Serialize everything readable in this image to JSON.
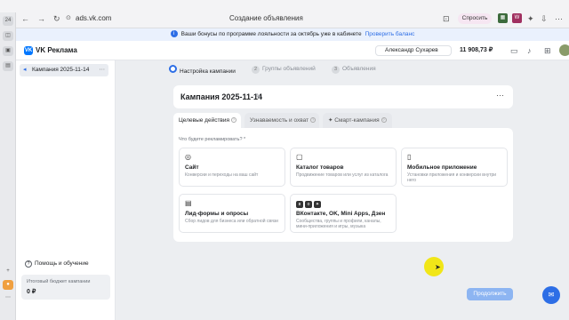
{
  "browser": {
    "address": "ads.vk.com",
    "page_title": "Создание объявления",
    "ask_label": "Спросить",
    "vtabs": [
      "24",
      "◫",
      "▣",
      "▤"
    ]
  },
  "banner": {
    "text": "Ваши бонусы по программе лояльности за октябрь уже в кабинете",
    "link": "Проверить баланс"
  },
  "header": {
    "logo": "VK Реклама",
    "account": "Александр Сухарев",
    "balance": "11 908,73 ₽"
  },
  "sidebar": {
    "campaign": "Кампания 2025-11-14",
    "help": "Помощь и обучение",
    "budget_label": "Итоговый бюджет кампании",
    "budget_value": "0 ₽"
  },
  "stepper": [
    {
      "num": "1",
      "label": "Настройка кампании"
    },
    {
      "num": "2",
      "label": "Группы объявлений"
    },
    {
      "num": "3",
      "label": "Объявления"
    }
  ],
  "campaign_title": "Кампания 2025-11-14",
  "tabs": [
    {
      "label": "Целевые действия"
    },
    {
      "label": "Узнаваемость и охват"
    },
    {
      "label": "Смарт-кампания"
    }
  ],
  "question": "Что будете рекламировать? *",
  "options": [
    {
      "title": "Сайт",
      "desc": "Конверсии и переходы на ваш сайт"
    },
    {
      "title": "Каталог товаров",
      "desc": "Продвижение товаров или услуг из каталога"
    },
    {
      "title": "Мобильное приложение",
      "desc": "Установки приложения и конверсии внутри него"
    },
    {
      "title": "Лид-формы и опросы",
      "desc": "Сбор лидов для бизнеса или обратной связи"
    },
    {
      "title": "ВКонтакте, OK, Mini Apps, Дзен",
      "desc": "Сообщества, группы и профили, каналы, мини-приложения и игры, музыка"
    }
  ],
  "continue_label": "Продолжить"
}
